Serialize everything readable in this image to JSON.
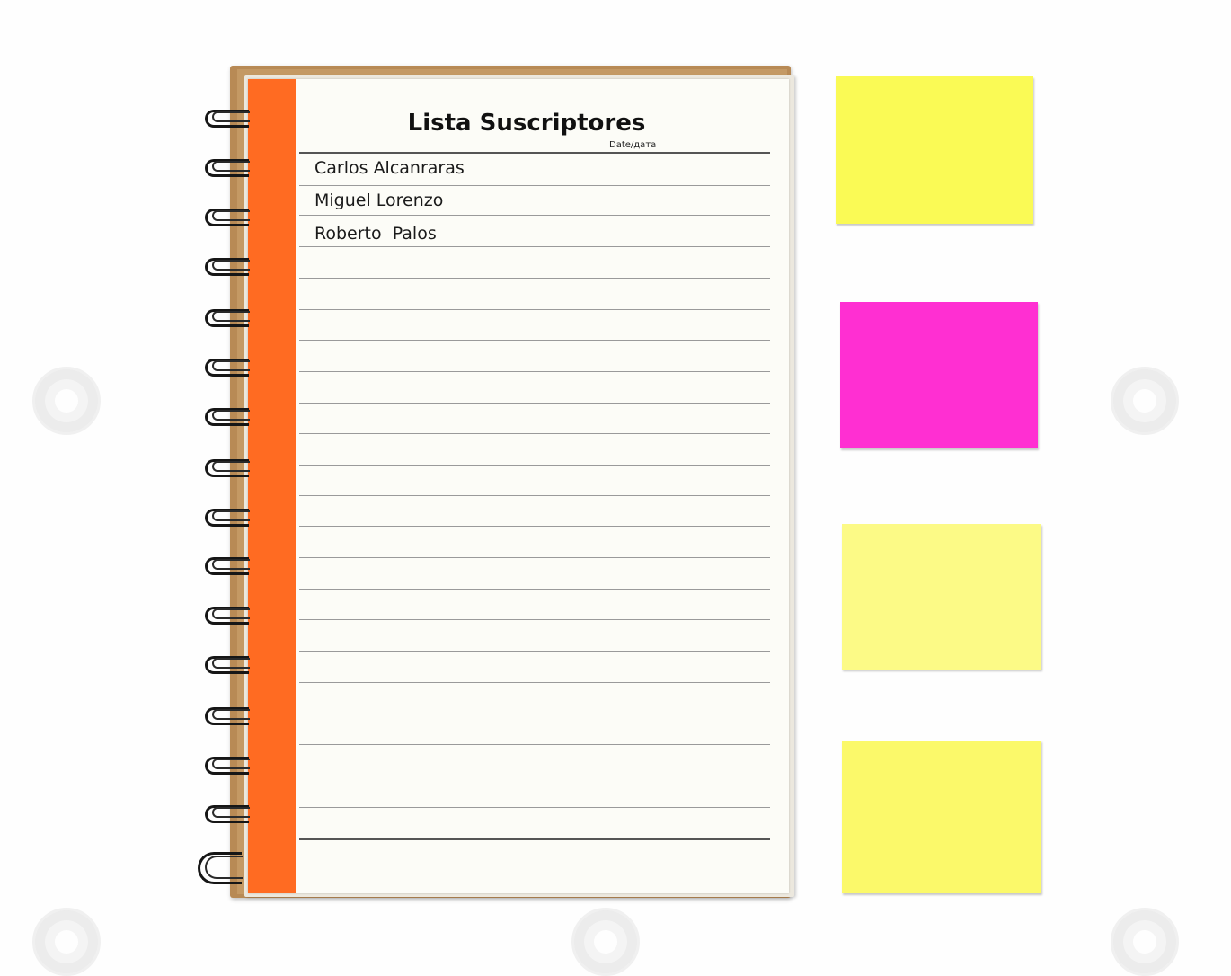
{
  "notebook": {
    "title": "Lista Suscriptores",
    "date_label": "Date/дата",
    "entries": [
      "Carlos Alcanraras",
      "Miguel Lorenzo",
      "Roberto  Palos"
    ]
  },
  "sticky_notes": [
    {
      "color": "#fafa55"
    },
    {
      "color": "#ff2fd2"
    },
    {
      "color": "#fcfa86"
    },
    {
      "color": "#fbf96a"
    }
  ],
  "colors": {
    "notebook_cover": "#b88a55",
    "page": "#fcfcf7",
    "margin_strip": "#ff6b22",
    "spiral": "#161616"
  }
}
